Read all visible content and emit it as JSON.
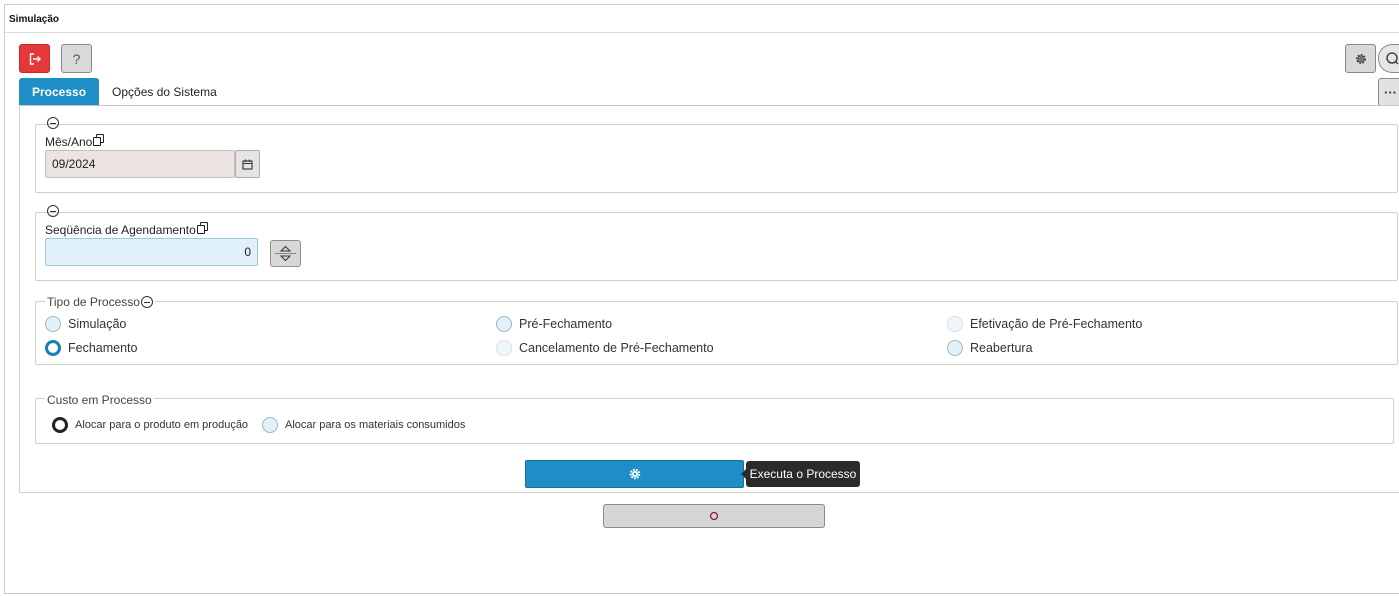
{
  "window": {
    "title": "Simulação"
  },
  "toolbar": {
    "exit_icon": "exit-icon",
    "help_label": "?",
    "settings_icon": "gear-icon",
    "search_icon": "search-icon",
    "more_label": "···",
    "exit_color": "#e5383b"
  },
  "tabs": [
    {
      "label": "Processo",
      "active": true
    },
    {
      "label": "Opções do Sistema",
      "active": false
    }
  ],
  "period": {
    "label": "Mês/Ano",
    "value": "09/2024",
    "calendar_icon": "calendar-icon"
  },
  "sequence": {
    "label": "Seqüência de Agendamento",
    "value": "0"
  },
  "process_type": {
    "legend": "Tipo de Processo",
    "options": [
      {
        "label": "Simulação",
        "selected": false
      },
      {
        "label": "Pré-Fechamento",
        "selected": false
      },
      {
        "label": "Efetivação de Pré-Fechamento",
        "selected": false
      },
      {
        "label": "Fechamento",
        "selected": true
      },
      {
        "label": "Cancelamento de Pré-Fechamento",
        "selected": false
      },
      {
        "label": "Reabertura",
        "selected": false
      }
    ]
  },
  "cost_in_process": {
    "legend": "Custo em Processo",
    "options": [
      {
        "label": "Alocar para o produto em produção",
        "selected": true
      },
      {
        "label": "Alocar para os materiais consumidos",
        "selected": false
      }
    ]
  },
  "actions": {
    "execute_icon": "gear-icon",
    "execute_tooltip": "Executa o Processo",
    "cancel_icon": "circle-icon",
    "accent_color": "#1e8ec6"
  }
}
